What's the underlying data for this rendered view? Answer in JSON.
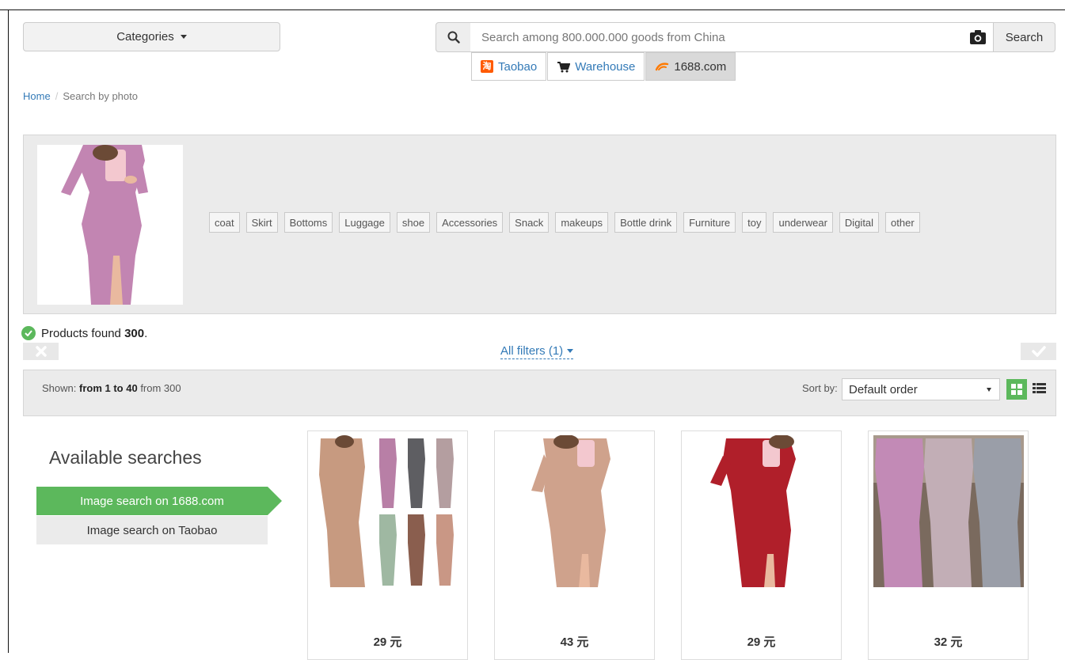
{
  "header": {
    "categories_label": "Categories",
    "search_placeholder": "Search among 800.000.000 goods from China",
    "search_button": "Search"
  },
  "source_tabs": [
    {
      "label": "Taobao",
      "icon": "taobao-icon",
      "active": false
    },
    {
      "label": "Warehouse",
      "icon": "cart-icon",
      "active": false
    },
    {
      "label": "1688.com",
      "icon": "1688-logo-icon",
      "active": true
    }
  ],
  "breadcrumb": {
    "home": "Home",
    "sep": "/",
    "current": "Search by photo"
  },
  "photo_panel": {
    "tags": [
      "coat",
      "Skirt",
      "Bottoms",
      "Luggage",
      "shoe",
      "Accessories",
      "Snack",
      "makeups",
      "Bottle drink",
      "Furniture",
      "toy",
      "underwear",
      "Digital",
      "other"
    ]
  },
  "results": {
    "found_prefix": "Products found",
    "found_count": "300",
    "found_suffix": ".",
    "all_filters": "All filters (1)"
  },
  "toolbar": {
    "shown_label": "Shown:",
    "shown_range": "from 1 to 40",
    "shown_total": "from 300",
    "sort_label": "Sort by:",
    "sort_value": "Default order"
  },
  "available_searches": {
    "title": "Available searches",
    "items": [
      {
        "label": "Image search on 1688.com",
        "active": true
      },
      {
        "label": "Image search on Taobao",
        "active": false
      }
    ]
  },
  "products": [
    {
      "price": "29 元",
      "colors": [
        "#c79a80",
        "#b87fa6",
        "#5e5e62",
        "#b49ea0",
        "#9fb8a2",
        "#8a5e4e",
        "#c99785"
      ]
    },
    {
      "price": "43 元",
      "colors": [
        "#cfa28c"
      ]
    },
    {
      "price": "29 元",
      "colors": [
        "#b01f2a"
      ]
    },
    {
      "price": "32 元",
      "colors": [
        "#c28ab6",
        "#c2aeb6",
        "#9a9ea8"
      ]
    }
  ],
  "colors": {
    "accent_green": "#5cb85c",
    "link_blue": "#337ab7",
    "query_dress": "#c285b2"
  }
}
